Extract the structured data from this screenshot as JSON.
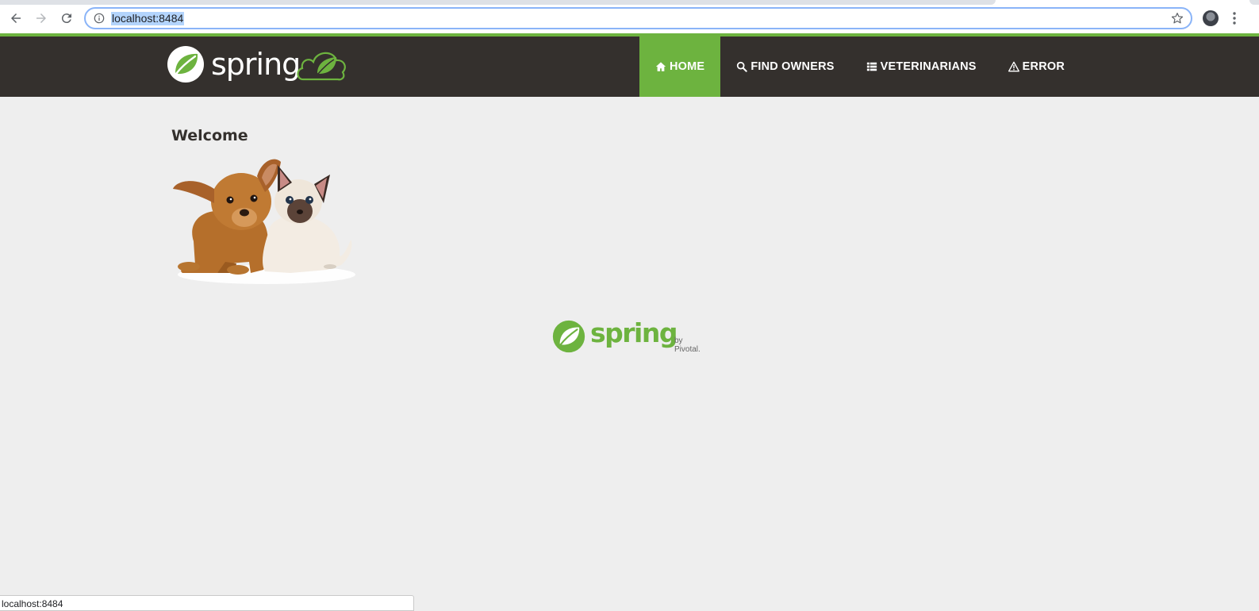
{
  "browser": {
    "url": "localhost:8484",
    "status_url": "localhost:8484"
  },
  "navbar": {
    "brand_text": "spring",
    "items": [
      {
        "label": "HOME",
        "icon": "home-icon",
        "active": true
      },
      {
        "label": "FIND OWNERS",
        "icon": "search-icon",
        "active": false
      },
      {
        "label": "VETERINARIANS",
        "icon": "list-icon",
        "active": false
      },
      {
        "label": "ERROR",
        "icon": "warning-icon",
        "active": false
      }
    ]
  },
  "main": {
    "title": "Welcome",
    "image_name": "pets-image"
  },
  "footer": {
    "brand_text": "spring",
    "by_text": "by Pivotal."
  },
  "colors": {
    "spring_green": "#6db33f",
    "navbar_bg": "#34302d",
    "page_bg": "#eeeeee"
  }
}
